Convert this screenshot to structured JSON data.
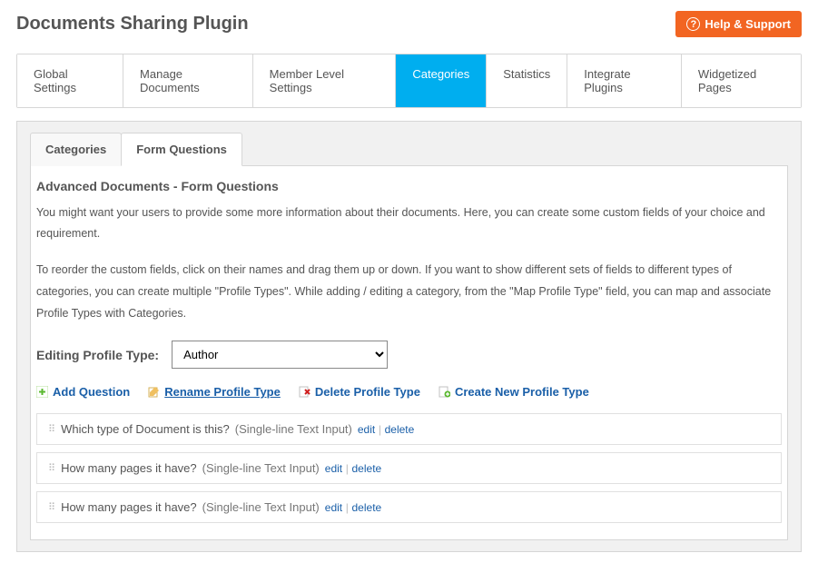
{
  "page": {
    "title": "Documents Sharing Plugin",
    "help_label": "Help & Support"
  },
  "tabs": {
    "global": "Global Settings",
    "manage": "Manage Documents",
    "member": "Member Level Settings",
    "categories": "Categories",
    "statistics": "Statistics",
    "integrate": "Integrate Plugins",
    "widget": "Widgetized Pages"
  },
  "subtabs": {
    "categories": "Categories",
    "form": "Form Questions"
  },
  "section": {
    "title": "Advanced Documents - Form Questions",
    "desc1": "You might want your users to provide some more information about their documents. Here, you can create some custom fields of your choice and requirement.",
    "desc2": "To reorder the custom fields, click on their names and drag them up or down. If you want to show different sets of fields to different types of categories, you can create multiple \"Profile Types\". While adding / editing a category, from the \"Map Profile Type\" field, you can map and associate Profile Types with Categories."
  },
  "profile": {
    "label": "Editing Profile Type:",
    "selected": "Author"
  },
  "actions": {
    "add": "Add Question",
    "rename": "Rename Profile Type",
    "delete": "Delete Profile Type",
    "create": "Create New Profile Type"
  },
  "fields": [
    {
      "label": "Which type of Document is this?",
      "type": "(Single-line Text Input)"
    },
    {
      "label": "How many pages it have?",
      "type": "(Single-line Text Input)"
    },
    {
      "label": "How many pages it have?",
      "type": "(Single-line Text Input)"
    }
  ],
  "links": {
    "edit": "edit",
    "delete": "delete"
  }
}
